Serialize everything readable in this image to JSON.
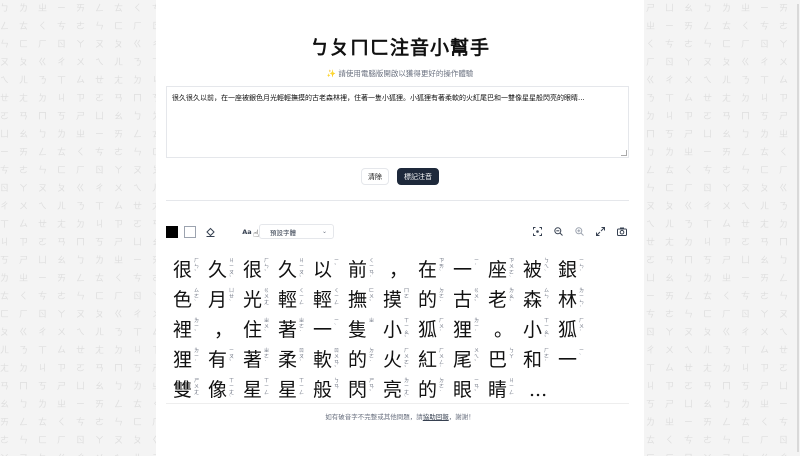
{
  "background_glyphs": "ㄅㄆㄇㄈㄉㄊㄋㄌㄍㄎㄏㄐㄑㄒㄓㄔㄕㄖㄗㄘㄙㄧㄨㄩㄚㄛㄜㄝㄞㄟㄠㄡㄢㄣㄤㄥㄦ",
  "header": {
    "title": "ㄅㄆㄇㄈ注音小幫手",
    "subtitle": "✨ 請使用電腦版開啟以獲得更好的操作體驗"
  },
  "input": {
    "value": "很久很久以前，在一座被銀色月光輕輕撫摸的古老森林裡，住著一隻小狐狸。小狐狸有著柔軟的火紅尾巴和一雙像星星般閃亮的眼睛..."
  },
  "actions": {
    "clear_label": "清除",
    "mark_label": "標記注音"
  },
  "toolbar": {
    "font_icon": "Aa",
    "font_select_value": "預設字體",
    "icons": [
      "color-black-swatch",
      "color-white-swatch",
      "paint-bucket-icon",
      "focus-icon",
      "zoom-out-icon",
      "zoom-in-icon",
      "fullscreen-icon",
      "camera-icon"
    ]
  },
  "output": {
    "rows": [
      [
        {
          "c": "很",
          "z": "ㄏㄣˇ"
        },
        {
          "c": "久",
          "z": "ㄐㄧㄡˇ"
        },
        {
          "c": "很",
          "z": "ㄏㄣˇ"
        },
        {
          "c": "久",
          "z": "ㄐㄧㄡˇ"
        },
        {
          "c": "以",
          "z": "ㄧˇ"
        },
        {
          "c": "前",
          "z": "ㄑㄧㄢˊ"
        },
        {
          "c": "，",
          "z": ""
        },
        {
          "c": "在",
          "z": "ㄗㄞˋ"
        },
        {
          "c": "一",
          "z": "ㄧˊ"
        },
        {
          "c": "座",
          "z": "ㄗㄨㄛˋ"
        },
        {
          "c": "被",
          "z": "ㄅㄟˋ"
        },
        {
          "c": "銀",
          "z": "ㄧㄣˊ"
        }
      ],
      [
        {
          "c": "色",
          "z": "ㄙㄜˋ"
        },
        {
          "c": "月",
          "z": "ㄩㄝˋ"
        },
        {
          "c": "光",
          "z": "ㄍㄨㄤ"
        },
        {
          "c": "輕",
          "z": "ㄑㄧㄥ"
        },
        {
          "c": "輕",
          "z": "ㄑㄧㄥ"
        },
        {
          "c": "撫",
          "z": "ㄈㄨˇ"
        },
        {
          "c": "摸",
          "z": "ㄇㄛ"
        },
        {
          "c": "的",
          "z": "ㄉㄜ˙"
        },
        {
          "c": "古",
          "z": "ㄍㄨˇ"
        },
        {
          "c": "老",
          "z": "ㄌㄠˇ"
        },
        {
          "c": "森",
          "z": "ㄙㄣ"
        },
        {
          "c": "林",
          "z": "ㄌㄧㄣˊ"
        }
      ],
      [
        {
          "c": "裡",
          "z": "ㄌㄧˇ"
        },
        {
          "c": "，",
          "z": ""
        },
        {
          "c": "住",
          "z": "ㄓㄨˋ"
        },
        {
          "c": "著",
          "z": "ㄓㄜ˙"
        },
        {
          "c": "一",
          "z": "ㄧˋ"
        },
        {
          "c": "隻",
          "z": "ㄓ"
        },
        {
          "c": "小",
          "z": "ㄒㄧㄠˇ"
        },
        {
          "c": "狐",
          "z": "ㄏㄨˊ"
        },
        {
          "c": "狸",
          "z": "ㄌㄧˊ"
        },
        {
          "c": "。",
          "z": ""
        },
        {
          "c": "小",
          "z": "ㄒㄧㄠˇ"
        },
        {
          "c": "狐",
          "z": "ㄏㄨˊ"
        }
      ],
      [
        {
          "c": "狸",
          "z": "ㄌㄧˊ"
        },
        {
          "c": "有",
          "z": "ㄧㄡˇ"
        },
        {
          "c": "著",
          "z": "ㄓㄜ˙"
        },
        {
          "c": "柔",
          "z": "ㄖㄡˊ"
        },
        {
          "c": "軟",
          "z": "ㄖㄨㄢˇ"
        },
        {
          "c": "的",
          "z": "ㄉㄜ˙"
        },
        {
          "c": "火",
          "z": "ㄏㄨㄛˇ"
        },
        {
          "c": "紅",
          "z": "ㄏㄨㄥˊ"
        },
        {
          "c": "尾",
          "z": "ㄨㄟˇ"
        },
        {
          "c": "巴",
          "z": "ㄅㄚ"
        },
        {
          "c": "和",
          "z": "ㄏㄜˊ"
        },
        {
          "c": "一",
          "z": "ㄧˋ"
        }
      ],
      [
        {
          "c": "雙",
          "z": "ㄕㄨㄤ"
        },
        {
          "c": "像",
          "z": "ㄒㄧㄤˋ"
        },
        {
          "c": "星",
          "z": "ㄒㄧㄥ"
        },
        {
          "c": "星",
          "z": "ㄒㄧㄥ"
        },
        {
          "c": "般",
          "z": "ㄅㄢ"
        },
        {
          "c": "閃",
          "z": "ㄕㄢˇ"
        },
        {
          "c": "亮",
          "z": "ㄌㄧㄤˋ"
        },
        {
          "c": "的",
          "z": "ㄉㄜ˙"
        },
        {
          "c": "眼",
          "z": "ㄧㄢˇ"
        },
        {
          "c": "睛",
          "z": "ㄐㄧㄥ"
        },
        {
          "c": "...",
          "z": ""
        }
      ]
    ]
  },
  "footer": {
    "prefix": "如有破音字不完整或其他問題，請",
    "link": "協助回報",
    "suffix": "，謝謝！"
  }
}
